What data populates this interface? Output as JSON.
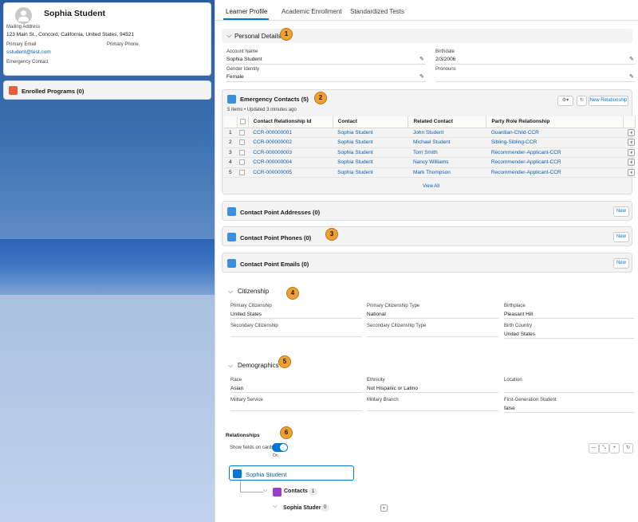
{
  "profile": {
    "name": "Sophia Student",
    "mailing_label": "Mailing Address",
    "mailing_value": "123 Main St., Concord, California, United States, 94521",
    "email_label": "Primary Email",
    "email_value": "sstudent@test.com",
    "phone_label": "Primary Phone",
    "emergency_label": "Emergency Contact"
  },
  "enrolled": {
    "title": "Enrolled Programs (0)"
  },
  "tabs": [
    "Learner Profile",
    "Academic Enrollment",
    "Standardized Tests"
  ],
  "personal": {
    "title": "Personal Details",
    "badge": "1",
    "account_name_label": "Account Name",
    "account_name_value": "Sophia Student",
    "birthdate_label": "Birthdate",
    "birthdate_value": "2/3/2006",
    "gender_label": "Gender Identity",
    "gender_value": "Female",
    "pronouns_label": "Pronouns"
  },
  "emergency": {
    "title": "Emergency Contacts (5)",
    "badge": "2",
    "meta": "5 items • Updated 3 minutes ago",
    "new_btn": "New Relationship",
    "columns": [
      "Contact Relationship Id",
      "Contact",
      "Related Contact",
      "Party Role Relationship"
    ],
    "rows": [
      {
        "num": "1",
        "id": "CCR-000000001",
        "contact": "Sophia Student",
        "related": "John Student",
        "role": "Guardian-Child-CCR"
      },
      {
        "num": "2",
        "id": "CCR-000000002",
        "contact": "Sophia Student",
        "related": "Michael Student",
        "role": "Sibling-Sibling-CCR"
      },
      {
        "num": "3",
        "id": "CCR-000000003",
        "contact": "Sophia Student",
        "related": "Tom Smith",
        "role": "Recommender-Applicant-CCR"
      },
      {
        "num": "4",
        "id": "CCR-000000004",
        "contact": "Sophia Student",
        "related": "Nancy Williams",
        "role": "Recommender-Applicant-CCR"
      },
      {
        "num": "5",
        "id": "CCR-000000005",
        "contact": "Sophia Student",
        "related": "Mark Thompson",
        "role": "Recommender-Applicant-CCR"
      }
    ],
    "view_all": "View All"
  },
  "addresses": {
    "title": "Contact Point Addresses (0)",
    "new_btn": "New"
  },
  "phones": {
    "title": "Contact Point Phones (0)",
    "new_btn": "New",
    "badge": "3"
  },
  "emails": {
    "title": "Contact Point Emails (0)",
    "new_btn": "New"
  },
  "citizenship": {
    "title": "Citizenship",
    "badge": "4",
    "primary_label": "Primary Citizenship",
    "primary_value": "United States",
    "type_label": "Primary Citizenship Type",
    "type_value": "National",
    "birthplace_label": "Birthplace",
    "birthplace_value": "Pleasant Hill",
    "secondary_label": "Secondary Citizenship",
    "secondary_type_label": "Secondary Citizenship Type",
    "birth_country_label": "Birth Country",
    "birth_country_value": "United States"
  },
  "demographics": {
    "title": "Demographics",
    "badge": "5",
    "race_label": "Race",
    "race_value": "Asian",
    "ethnicity_label": "Ethnicity",
    "ethnicity_value": "Not Hispanic or Latino",
    "location_label": "Location",
    "military_service_label": "Military Service",
    "military_branch_label": "Military Branch",
    "first_gen_label": "First-Generation Student",
    "first_gen_value": "false"
  },
  "relationships": {
    "title": "Relationships",
    "badge": "6",
    "toggle_label": "Show fields on cards",
    "toggle_state": "On",
    "root_name": "Sophia Student",
    "contacts_label": "Contacts",
    "contacts_count": "1",
    "child_name": "Sophia Student",
    "child_count": "0"
  },
  "colors": {
    "accent": "#0176d3",
    "badge": "#f0a030"
  }
}
